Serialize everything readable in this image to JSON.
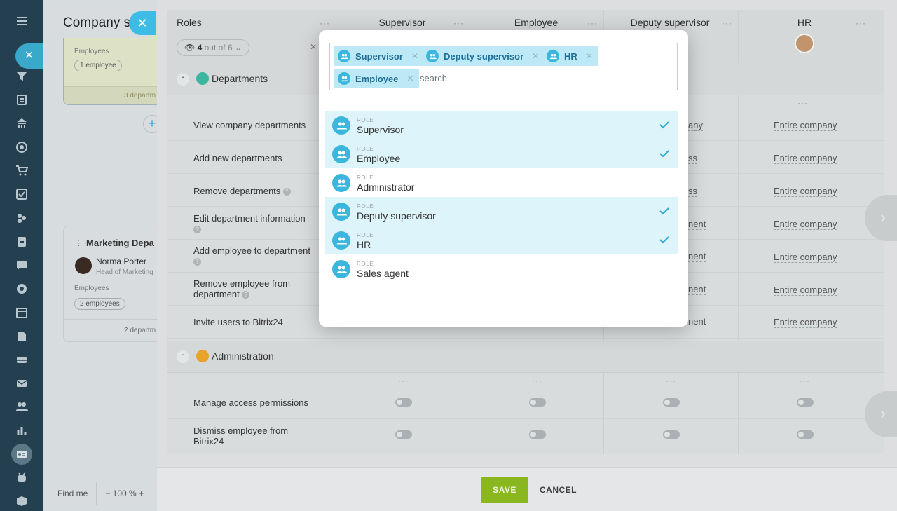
{
  "background": {
    "page_title": "Company s",
    "card1": {
      "employees_label": "Employees",
      "employees_count": "1 employee",
      "footer": "3 departm"
    },
    "card2": {
      "title": "Marketing Depa",
      "person_name": "Norma Porter",
      "person_role": "Head of Marketing",
      "employees_label": "Employees",
      "employees_count": "2 employees",
      "footer": "2 departm"
    },
    "zoom": {
      "find_me": "Find me",
      "zoom_text": "− 100 % +"
    }
  },
  "table": {
    "roles_header": "Roles",
    "visibility": {
      "shown": "4",
      "rest": "out of 6"
    },
    "columns": [
      "Supervisor",
      "Employee",
      "Deputy supervisor",
      "HR"
    ],
    "sections": {
      "departments": "Departments",
      "administration": "Administration"
    },
    "department_rows": [
      {
        "label": "View company departments",
        "deputy": "any",
        "hr": "Entire company"
      },
      {
        "label": "Add new departments",
        "deputy": "ss",
        "hr": "Entire company"
      },
      {
        "label": "Remove departments",
        "deputy": "ss",
        "hr": "Entire company"
      },
      {
        "label": "Edit department information",
        "deputy": "nent",
        "hr": "Entire company"
      },
      {
        "label": "Add employee to department",
        "deputy": "nent",
        "hr": "Entire company"
      },
      {
        "label": "Remove employee from department",
        "deputy": "nent",
        "hr": "Entire company"
      },
      {
        "label": "Invite users to Bitrix24",
        "deputy": "nent",
        "hr": "Entire company"
      }
    ],
    "admin_rows": [
      {
        "label": "Manage access permissions"
      },
      {
        "label": "Dismiss employee from Bitrix24"
      }
    ]
  },
  "footer": {
    "save": "SAVE",
    "cancel": "CANCEL"
  },
  "dialog": {
    "selected_tags": [
      "Supervisor",
      "Deputy supervisor",
      "HR",
      "Employee"
    ],
    "search_placeholder": "search",
    "items": [
      {
        "caption": "ROLE",
        "name": "Supervisor",
        "selected": true
      },
      {
        "caption": "ROLE",
        "name": "Employee",
        "selected": true
      },
      {
        "caption": "ROLE",
        "name": "Administrator",
        "selected": false
      },
      {
        "caption": "ROLE",
        "name": "Deputy supervisor",
        "selected": true
      },
      {
        "caption": "ROLE",
        "name": "HR",
        "selected": true
      },
      {
        "caption": "ROLE",
        "name": "Sales agent",
        "selected": false
      }
    ]
  },
  "colors": {
    "accent": "#3bb6dd",
    "selected_bg": "#ddf4fb",
    "save_green": "#8ab71f",
    "sidebar": "#243f50"
  }
}
